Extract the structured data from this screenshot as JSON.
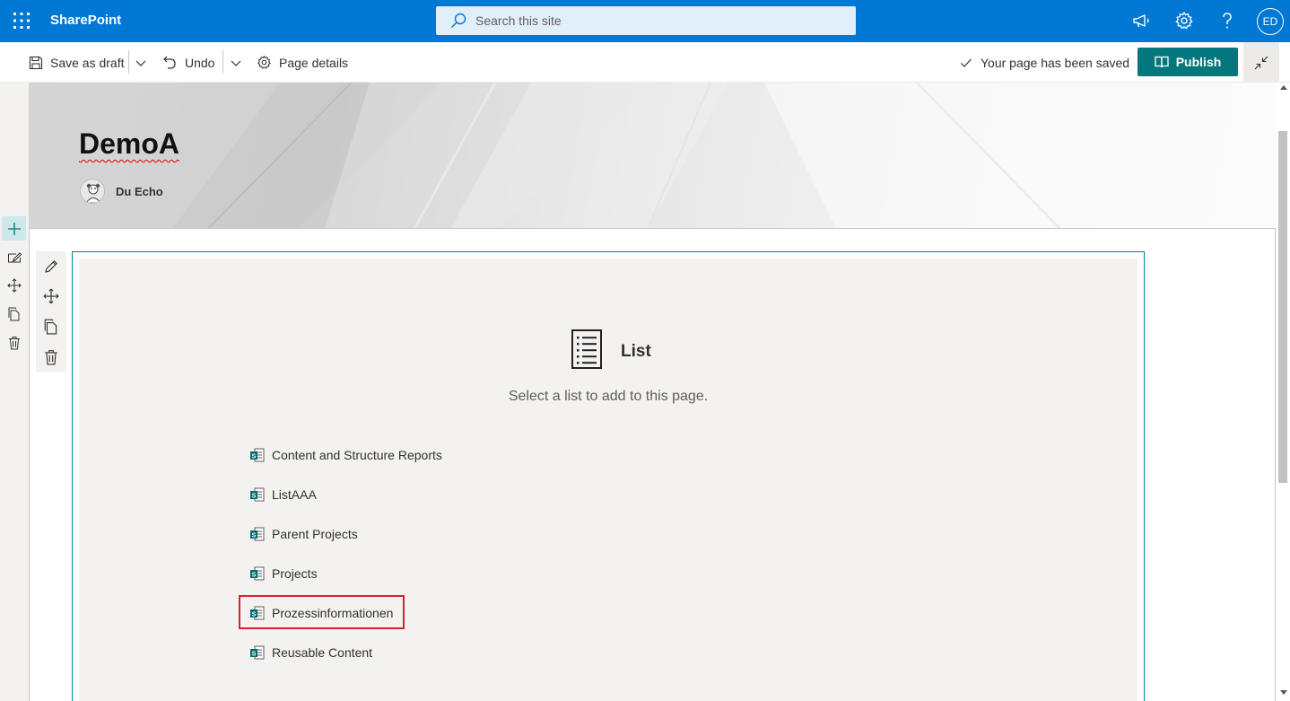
{
  "suite_bar": {
    "app_name": "SharePoint",
    "search_placeholder": "Search this site",
    "user_initials": "ED",
    "icons": [
      "waffle-icon",
      "megaphone-icon",
      "settings-icon",
      "help-icon"
    ]
  },
  "command_bar": {
    "save_draft_label": "Save as draft",
    "undo_label": "Undo",
    "page_details_label": "Page details",
    "saved_status": "Your page has been saved",
    "publish_label": "Publish"
  },
  "header": {
    "title": "DemoA",
    "author": "Du Echo"
  },
  "web_part": {
    "title": "List",
    "description": "Select a list to add to this page.",
    "lists": [
      {
        "label": "Content and Structure Reports"
      },
      {
        "label": "ListAAA"
      },
      {
        "label": "Parent Projects"
      },
      {
        "label": "Projects"
      },
      {
        "label": "Prozessinformationen"
      },
      {
        "label": "Reusable Content"
      }
    ]
  },
  "colors": {
    "suite_bar": "#0078d4",
    "publish": "#03787c",
    "accent": "#038387",
    "highlight": "#d6232e"
  }
}
